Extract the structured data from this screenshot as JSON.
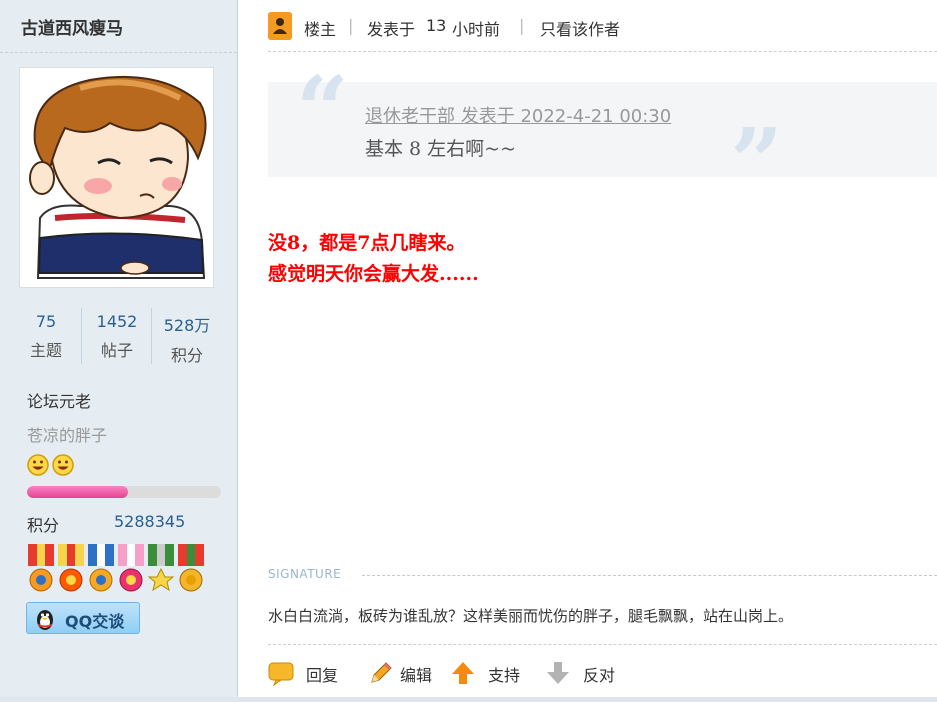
{
  "author": {
    "name": "古道西风瘦马",
    "stats": [
      {
        "value": "75",
        "label": "主题"
      },
      {
        "value": "1452",
        "label": "帖子"
      },
      {
        "value": "528万",
        "label": "积分"
      }
    ],
    "rank_title": "论坛元老",
    "rank_subtitle": "苍凉的胖子",
    "progress_fraction": 0.52,
    "points_label": "积分",
    "points_value": "5288345",
    "qq_button_label": "QQ交谈"
  },
  "post_header": {
    "owner_label": "楼主",
    "posted_prefix": "发表于",
    "posted_value": "13",
    "posted_suffix": "小时前",
    "only_author_label": "只看该作者",
    "separator": "|"
  },
  "quote": {
    "meta": "退休老干部 发表于 2022-4-21 00:30",
    "body": "基本  8 左右啊~~"
  },
  "post": {
    "lines": [
      "没8，都是7点几瞎来。",
      "感觉明天你会赢大发......"
    ]
  },
  "signature": {
    "label": "SIGNATURE",
    "text": "水白白流淌，板砖为谁乱放？这样美丽而忧伤的胖子，腿毛飘飘，站在山岗上。"
  },
  "actions": [
    {
      "label": "回复",
      "icon": "reply-bubble-icon"
    },
    {
      "label": "编辑",
      "icon": "pencil-icon"
    },
    {
      "label": "支持",
      "icon": "arrow-up-icon"
    },
    {
      "label": "反对",
      "icon": "arrow-down-icon"
    }
  ],
  "colors": {
    "sidebar_bg": "#e5edf2",
    "link_blue": "#2b5f8f",
    "post_red": "#ff0000",
    "owner_orange": "#f59a23",
    "progress_pink": "#e5438f"
  }
}
